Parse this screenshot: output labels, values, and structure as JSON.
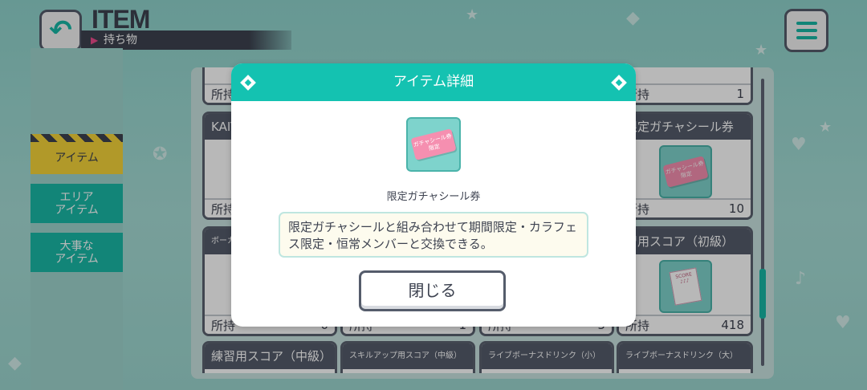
{
  "header": {
    "title": "ITEM",
    "subtitle": "持ち物",
    "back_icon": "back-arrow-icon",
    "menu_icon": "hamburger-menu-icon"
  },
  "sidebar": {
    "items": [
      {
        "label": "アイテム",
        "active": true
      },
      {
        "label": "エリア\nアイテム",
        "active": false
      },
      {
        "label": "大事な\nアイテム",
        "active": false
      }
    ]
  },
  "grid": {
    "count_label": "所持",
    "cards": [
      {
        "title": "",
        "count": ""
      },
      {
        "title": "",
        "count": "1"
      },
      {
        "title": "KAIT",
        "count": ""
      },
      {
        "title": "限定ガチャシール券",
        "count": "10"
      },
      {
        "title": "ボーカ",
        "count": "0"
      },
      {
        "title": "",
        "count": "1"
      },
      {
        "title": "",
        "count": "5"
      },
      {
        "title": "習用スコア（初級）",
        "count": "418"
      },
      {
        "title": "練習用スコア（中級）"
      },
      {
        "title": "スキルアップ用スコア（中級）"
      },
      {
        "title": "ライブボーナスドリンク（小）"
      },
      {
        "title": "ライブボーナスドリンク（大）"
      }
    ]
  },
  "modal": {
    "title": "アイテム詳細",
    "item_name": "限定ガチャシール券",
    "sticker_text_line1": "ガチャシール券",
    "sticker_text_line2": "限定",
    "description": "限定ガチャシールと組み合わせて期間限定・カラフェス限定・恒常メンバーと交換できる。",
    "close_label": "閉じる"
  },
  "colors": {
    "accent": "#14c2b1",
    "dark": "#3d4250",
    "highlight": "#f5d43a",
    "pink": "#f58fb0"
  }
}
